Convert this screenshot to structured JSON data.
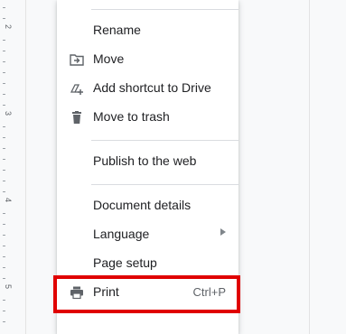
{
  "ruler": {
    "labels": [
      "2",
      "3",
      "4",
      "5"
    ]
  },
  "menu": {
    "items": [
      {
        "label": "Rename",
        "icon": ""
      },
      {
        "label": "Move",
        "icon": "move-to-folder-icon"
      },
      {
        "label": "Add shortcut to Drive",
        "icon": "add-shortcut-icon"
      },
      {
        "label": "Move to trash",
        "icon": "trash-icon"
      },
      {
        "label": "Publish to the web",
        "icon": ""
      },
      {
        "label": "Document details",
        "icon": ""
      },
      {
        "label": "Language",
        "icon": "",
        "submenu": true
      },
      {
        "label": "Page setup",
        "icon": ""
      },
      {
        "label": "Print",
        "icon": "print-icon",
        "shortcut": "Ctrl+P",
        "highlighted": true
      }
    ]
  },
  "colors": {
    "highlight_border": "#e00000",
    "menu_background": "#ffffff",
    "divider": "#dadce0"
  }
}
